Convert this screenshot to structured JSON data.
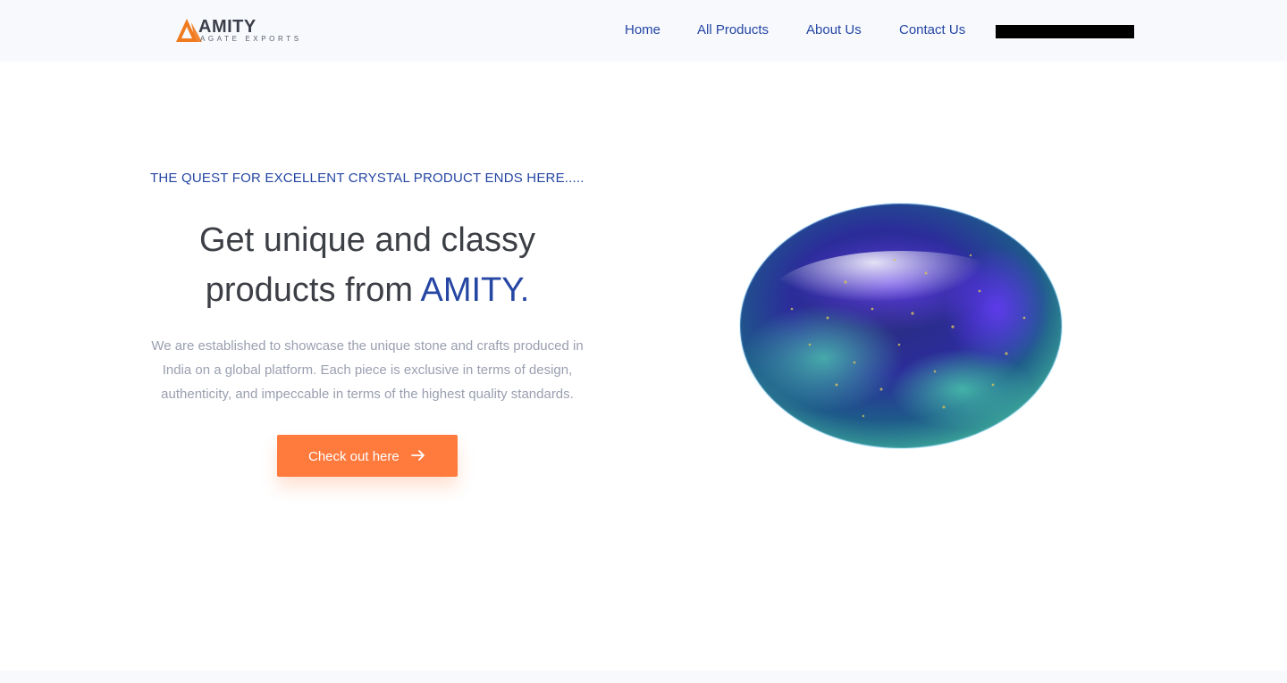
{
  "brand": {
    "name": "AMITY",
    "subtitle": "AGATE EXPORTS",
    "accent_color": "#2546a3",
    "logo_orange": "#f07a1e"
  },
  "nav": {
    "items": [
      {
        "label": "Home"
      },
      {
        "label": "All Products"
      },
      {
        "label": "About Us"
      },
      {
        "label": "Contact Us"
      }
    ]
  },
  "hero": {
    "tagline": "THE QUEST FOR EXCELLENT CRYSTAL PRODUCT ENDS HERE.....",
    "headline_line1": "Get unique and classy",
    "headline_line2_prefix": "products from ",
    "headline_brand": "AMITY.",
    "description": "We are established to showcase the unique stone and crafts produced in India on a global platform. Each piece is exclusive in terms of design, authenticity, and impeccable in terms of the highest quality standards.",
    "cta_label": "Check out here",
    "cta_color": "#ff7a3d",
    "image_icon": "gemstone-image"
  }
}
